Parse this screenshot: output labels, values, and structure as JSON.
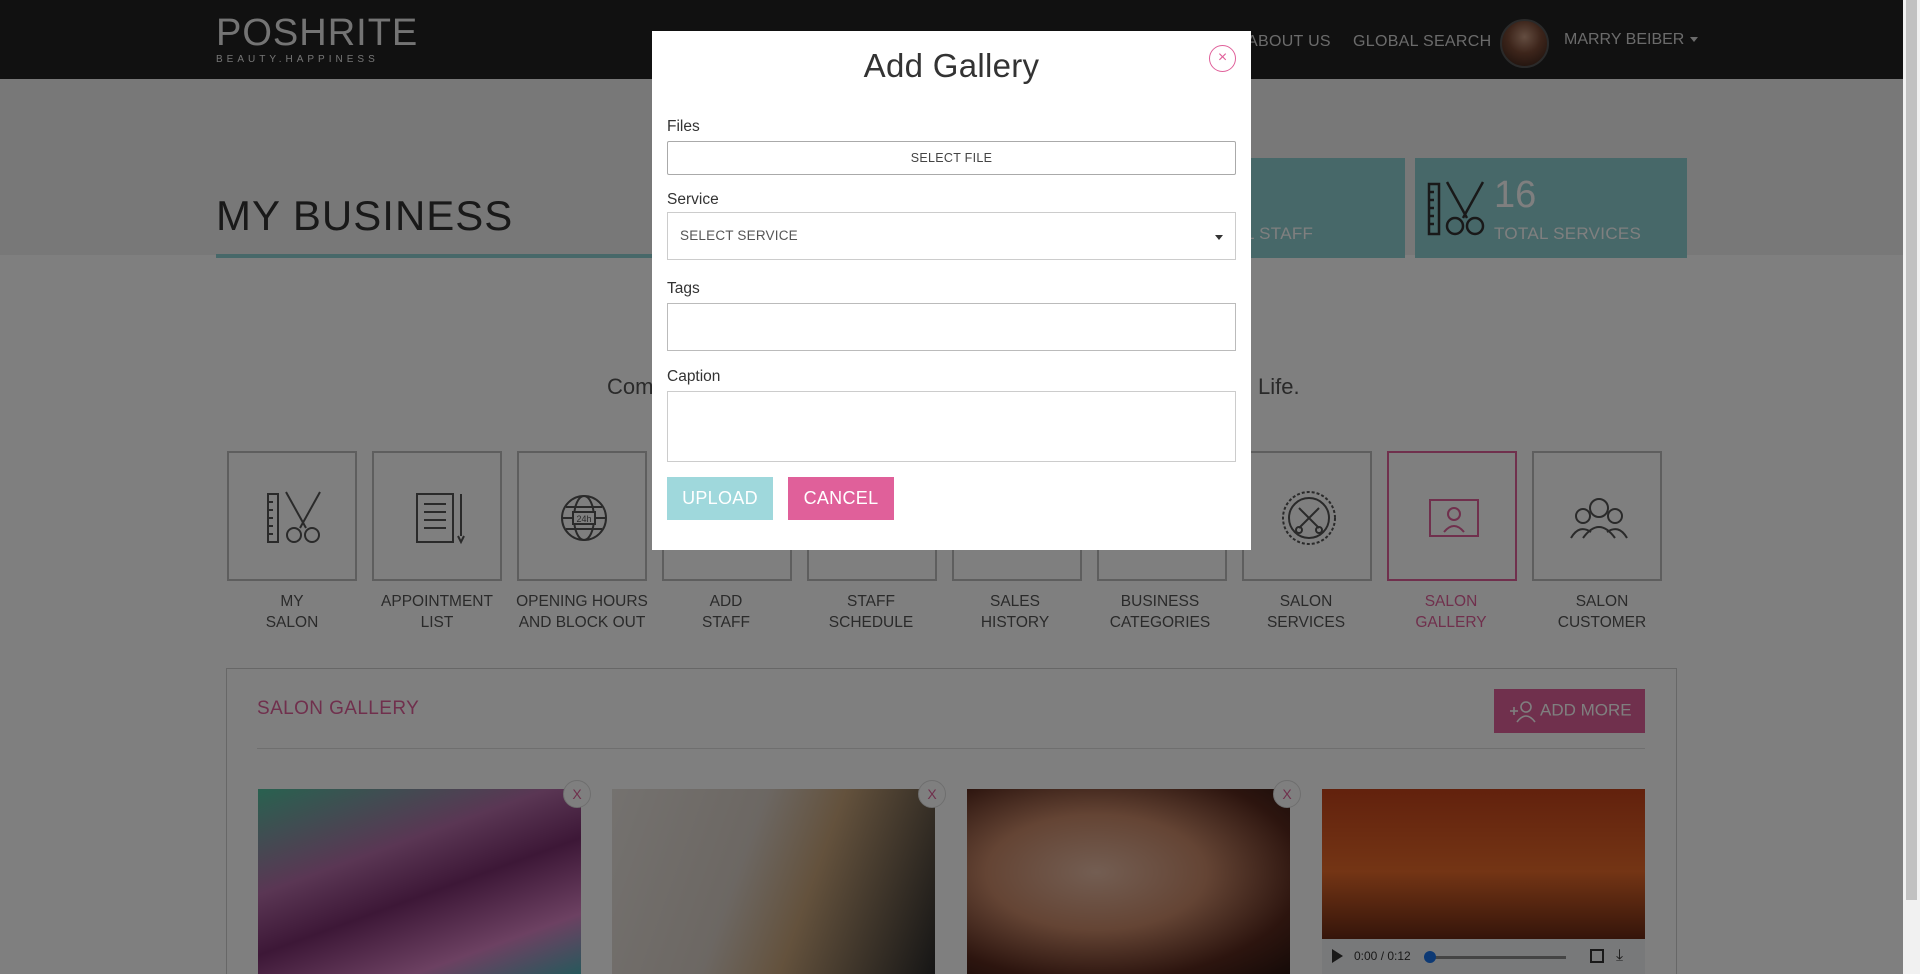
{
  "brand": {
    "name": "POSHRITE",
    "tagline": "BEAUTY.HAPPINESS"
  },
  "nav": {
    "about": "ABOUT US",
    "search": "GLOBAL SEARCH",
    "user": "MARRY BEIBER"
  },
  "page": {
    "title": "MY BUSINESS",
    "tagline_left": "Com",
    "tagline_right": "Life."
  },
  "stats": [
    {
      "number": "",
      "label": "L STAFF",
      "icon": "staff-icon"
    },
    {
      "number": "16",
      "label": "TOTAL SERVICES",
      "icon": "comb-scissors-icon"
    }
  ],
  "tiles": [
    {
      "label": "MY\nSALON",
      "icon": "comb-scissors-icon"
    },
    {
      "label": "APPOINTMENT\nLIST",
      "icon": "document-icon"
    },
    {
      "label": "OPENING HOURS\nAND BLOCK OUT",
      "icon": "globe-24h-icon"
    },
    {
      "label": "ADD\nSTAFF",
      "icon": "add-staff-icon"
    },
    {
      "label": "STAFF\nSCHEDULE",
      "icon": "schedule-icon"
    },
    {
      "label": "SALES\nHISTORY",
      "icon": "sales-icon"
    },
    {
      "label": "BUSINESS\nCATEGORIES",
      "icon": "categories-icon"
    },
    {
      "label": "SALON\nSERVICES",
      "icon": "badge-scissors-icon"
    },
    {
      "label": "SALON\nGALLERY",
      "icon": "photo-frame-icon",
      "active": true
    },
    {
      "label": "SALON\nCUSTOMER",
      "icon": "customers-icon"
    }
  ],
  "gallery": {
    "heading": "SALON GALLERY",
    "add_more": "ADD MORE",
    "delete_label": "X",
    "video_time": "0:00 / 0:12"
  },
  "modal": {
    "title": "Add Gallery",
    "close": "×",
    "files_label": "Files",
    "select_file": "SELECT FILE",
    "service_label": "Service",
    "service_value": "SELECT SERVICE",
    "tags_label": "Tags",
    "tags_value": "",
    "caption_label": "Caption",
    "caption_value": "",
    "upload": "UPLOAD",
    "cancel": "CANCEL"
  },
  "colors": {
    "accent_pink": "#e0609a",
    "accent_teal": "#8fd0d3",
    "header_bg": "#222222"
  }
}
